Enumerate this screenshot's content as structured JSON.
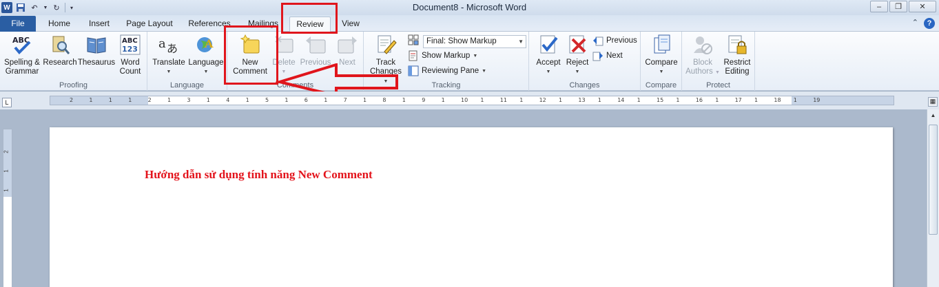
{
  "window": {
    "title": "Document8  -  Microsoft Word",
    "app_icon": "W"
  },
  "tabs": {
    "file": "File",
    "items": [
      "Home",
      "Insert",
      "Page Layout",
      "References",
      "Mailings",
      "Review",
      "View"
    ],
    "active": "Review"
  },
  "ribbon": {
    "proofing": {
      "label": "Proofing",
      "spelling": "Spelling &",
      "spelling2": "Grammar",
      "research": "Research",
      "thesaurus": "Thesaurus",
      "wordcount": "Word",
      "wordcount2": "Count"
    },
    "language": {
      "label": "Language",
      "translate": "Translate",
      "language": "Language"
    },
    "comments": {
      "label": "Comments",
      "new": "New",
      "new2": "Comment",
      "delete": "Delete",
      "previous": "Previous",
      "next": "Next"
    },
    "tracking": {
      "label": "Tracking",
      "track": "Track",
      "track2": "Changes",
      "markup_select": "Final: Show Markup",
      "show_markup": "Show Markup",
      "reviewing_pane": "Reviewing Pane"
    },
    "changes": {
      "label": "Changes",
      "accept": "Accept",
      "reject": "Reject",
      "previous": "Previous",
      "next": "Next"
    },
    "compare": {
      "label": "Compare",
      "compare": "Compare"
    },
    "protect": {
      "label": "Protect",
      "block": "Block",
      "block2": "Authors",
      "restrict": "Restrict",
      "restrict2": "Editing"
    }
  },
  "ruler": {
    "ticks": [
      "2",
      "1",
      "1",
      "1",
      "2",
      "1",
      "3",
      "1",
      "4",
      "1",
      "5",
      "1",
      "6",
      "1",
      "7",
      "1",
      "8",
      "1",
      "9",
      "1",
      "10",
      "1",
      "11",
      "1",
      "12",
      "1",
      "13",
      "1",
      "14",
      "1",
      "15",
      "1",
      "16",
      "1",
      "17",
      "1",
      "18",
      "1",
      "19"
    ],
    "vticks": [
      "2",
      "1",
      "1"
    ]
  },
  "document": {
    "text": "Hướng dẫn sử dụng tính năng New Comment"
  },
  "colors": {
    "annotation": "#e0151c",
    "file_tab": "#2a5ea3"
  }
}
